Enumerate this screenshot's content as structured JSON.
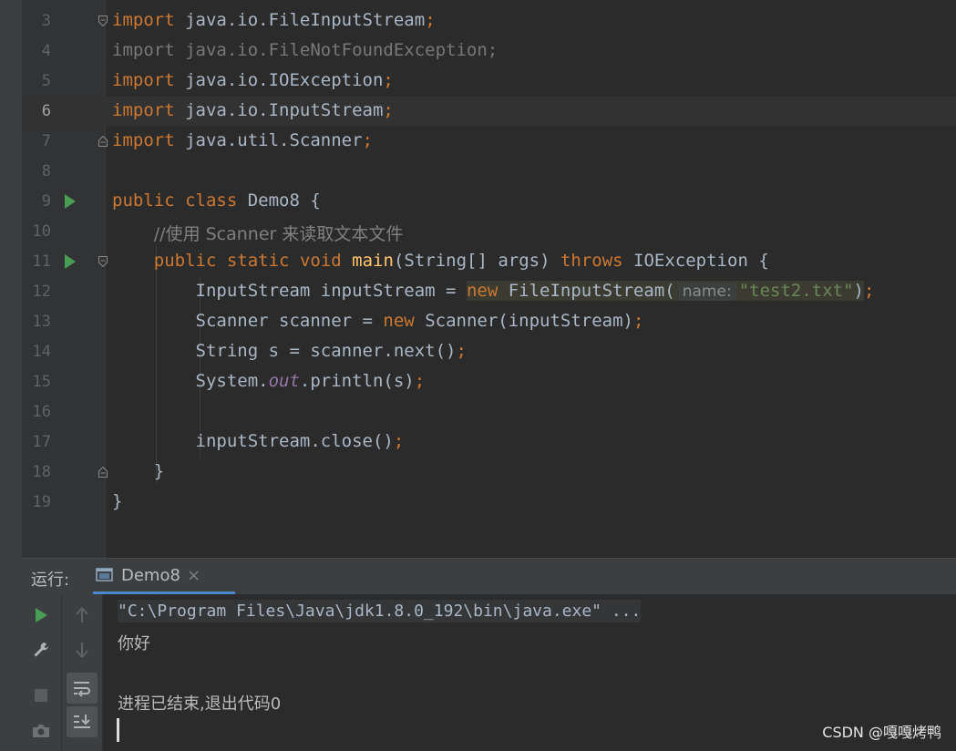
{
  "editor": {
    "lines": [
      {
        "num": "3"
      },
      {
        "num": "4"
      },
      {
        "num": "5"
      },
      {
        "num": "6"
      },
      {
        "num": "7"
      },
      {
        "num": "8"
      },
      {
        "num": "9"
      },
      {
        "num": "10"
      },
      {
        "num": "11"
      },
      {
        "num": "12"
      },
      {
        "num": "13"
      },
      {
        "num": "14"
      },
      {
        "num": "15"
      },
      {
        "num": "16"
      },
      {
        "num": "17"
      },
      {
        "num": "18"
      },
      {
        "num": "19"
      }
    ],
    "code": {
      "l3_kw": "import",
      "l3_rest": " java.io.FileInputStream",
      "l4_text": "import java.io.FileNotFoundException;",
      "l5_kw": "import",
      "l5_rest": " java.io.IOException",
      "l6_kw": "import",
      "l6_rest": " java.io.InputStream",
      "l7_kw": "import",
      "l7_rest": " java.util.Scanner",
      "l9_kw1": "public",
      "l9_kw2": "class",
      "l9_rest": " Demo8 {",
      "l10_comment": "//使用 Scanner 来读取文本文件",
      "l11_kw1": "public",
      "l11_kw2": "static",
      "l11_kw3": "void",
      "l11_fn": "main",
      "l11_mid": "(String[] args) ",
      "l11_kw4": "throws",
      "l11_end": " IOException {",
      "l12_pre": "InputStream inputStream = ",
      "l12_kw": "new",
      "l12_cls": " FileInputStream(",
      "l12_hint": "name:",
      "l12_str": "\"test2.txt\"",
      "l12_close": ")",
      "l13_pre": "Scanner scanner = ",
      "l13_kw": "new",
      "l13_rest": " Scanner(inputStream)",
      "l14_pre": "String s = scanner.next()",
      "l15_pre": "System.",
      "l15_field": "out",
      "l15_rest": ".println(s)",
      "l17_pre": "inputStream.close()",
      "l18_text": "}",
      "l19_text": "}",
      "semicolon": ";"
    }
  },
  "run_panel": {
    "label": "运行:",
    "tab_name": "Demo8",
    "tab_close": "×"
  },
  "console": {
    "command": "\"C:\\Program Files\\Java\\jdk1.8.0_192\\bin\\java.exe\" ...",
    "output": "你好",
    "exit_message": "进程已结束,退出代码0"
  },
  "watermark": "CSDN @嘎嘎烤鸭",
  "colors": {
    "keyword": "#cc7832",
    "string": "#6a8759",
    "function": "#ffc66d",
    "comment": "#808080",
    "run_green": "#499c54",
    "tab_accent": "#4a88c7"
  }
}
